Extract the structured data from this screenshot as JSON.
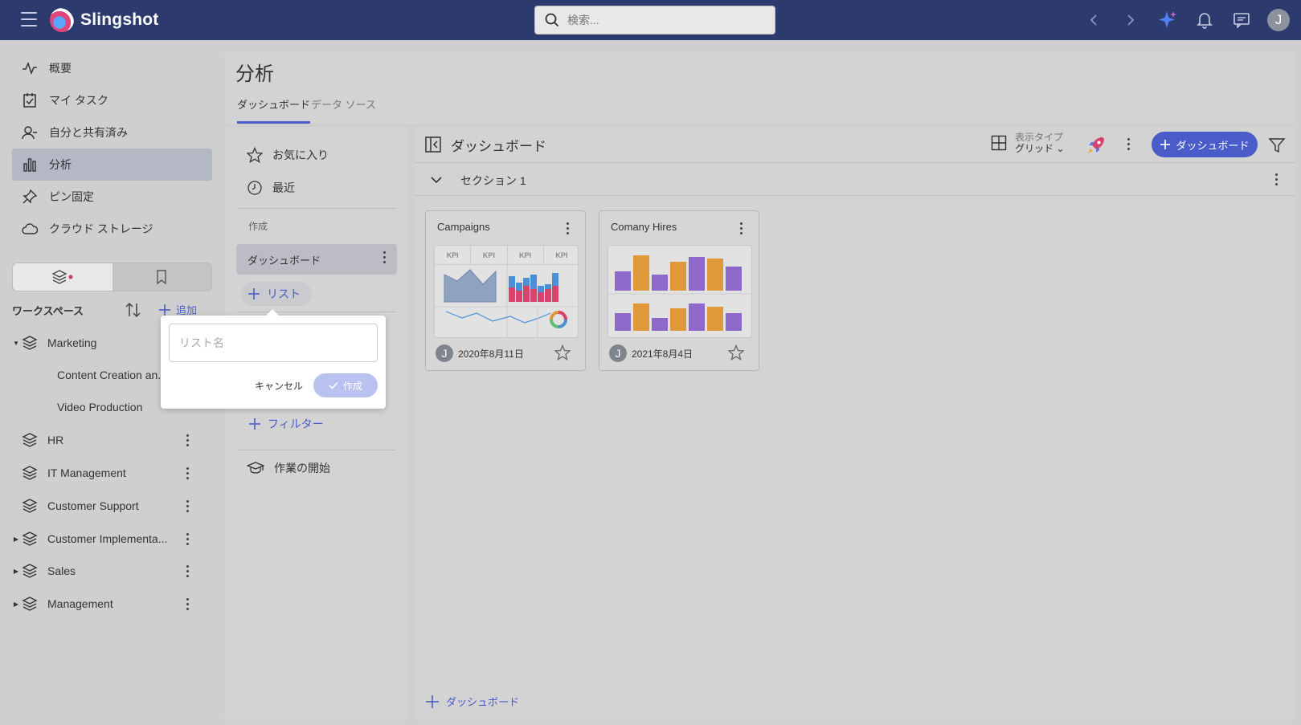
{
  "topbar": {
    "app_name": "Slingshot",
    "search_placeholder": "検索...",
    "avatar_initial": "J"
  },
  "nav": {
    "items": [
      {
        "label": "概要",
        "icon": "activity-icon"
      },
      {
        "label": "マイ タスク",
        "icon": "task-check-icon"
      },
      {
        "label": "自分と共有済み",
        "icon": "shared-user-icon"
      },
      {
        "label": "分析",
        "icon": "bar-chart-icon"
      },
      {
        "label": "ピン固定",
        "icon": "pin-icon"
      },
      {
        "label": "クラウド ストレージ",
        "icon": "cloud-icon"
      }
    ]
  },
  "workspace": {
    "title": "ワークスペース",
    "add_label": "追加",
    "items": [
      {
        "label": "Marketing"
      },
      {
        "label": "HR"
      },
      {
        "label": "IT Management"
      },
      {
        "label": "Customer Support"
      },
      {
        "label": "Customer Implementa..."
      },
      {
        "label": "Sales"
      },
      {
        "label": "Management"
      }
    ],
    "sub_items": [
      {
        "label": "Content Creation an..."
      },
      {
        "label": "Video Production"
      }
    ]
  },
  "page": {
    "title": "分析",
    "tabs": [
      {
        "label": "ダッシュボード"
      },
      {
        "label": "データ ソース"
      }
    ]
  },
  "middle": {
    "favorites": "お気に入り",
    "recent": "最近",
    "section_label": "作成",
    "active_list": "ダッシュボード",
    "add_list": "リスト",
    "add_filter": "フィルター",
    "getting_started": "作業の開始"
  },
  "popover": {
    "placeholder": "リスト名",
    "cancel": "キャンセル",
    "create": "作成"
  },
  "main": {
    "title": "ダッシュボード",
    "view_type_label": "表示タイプ",
    "view_type_value": "グリッド",
    "add_dashboard": "ダッシュボード",
    "section_title": "セクション 1",
    "bottom_add": "ダッシュボード",
    "cards": [
      {
        "title": "Campaigns",
        "date": "2020年8月11日",
        "avatar": "J",
        "kpis": [
          "KPI",
          "KPI",
          "KPI",
          "KPI"
        ]
      },
      {
        "title": "Comany Hires",
        "date": "2021年8月4日",
        "avatar": "J"
      }
    ]
  },
  "colors": {
    "topbar": "#2c3a6e",
    "accent": "#4a5cc7",
    "bar_orange": "#e0993a",
    "bar_purple": "#8e69c9"
  }
}
